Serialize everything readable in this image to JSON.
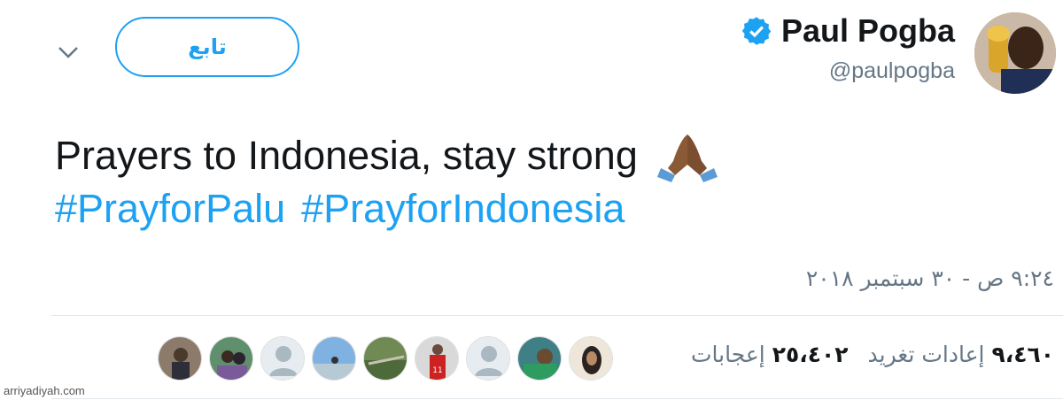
{
  "header": {
    "follow_label": "تابع",
    "display_name": "Paul Pogba",
    "handle": "@paulpogba"
  },
  "tweet": {
    "text": "Prayers to Indonesia, stay strong",
    "emoji_icon": "folded-hands-emoji",
    "hashtags": [
      "#PrayforPalu",
      "#PrayforIndonesia"
    ]
  },
  "meta": {
    "timestamp": "٩:٢٤ ص - ٣٠ سبتمبر ٢٠١٨"
  },
  "stats": {
    "retweets_count": "٩،٤٦٠",
    "retweets_label": "إعادات تغريد",
    "likes_count": "٢٥،٤٠٢",
    "likes_label": "إعجابات"
  },
  "likers_count_shown": 9,
  "watermark": "arriyadiyah.com",
  "colors": {
    "accent": "#1da1f2",
    "secondary_text": "#657786",
    "primary_text": "#14171a"
  }
}
